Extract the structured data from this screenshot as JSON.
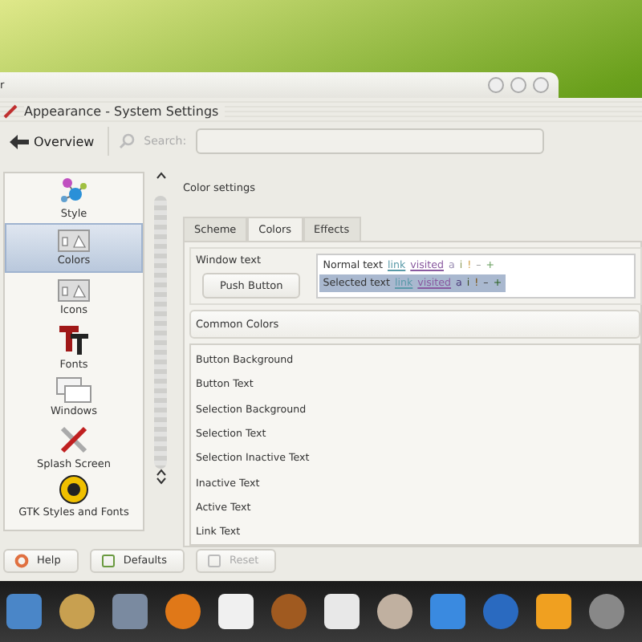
{
  "back_window": {
    "title": "r"
  },
  "window": {
    "title": "Appearance - System Settings"
  },
  "toolbar": {
    "overview": "Overview",
    "search_label": "Search:"
  },
  "sidebar": {
    "items": [
      {
        "label": "Style",
        "kind": "style",
        "selected": false
      },
      {
        "label": "Colors",
        "kind": "colors",
        "selected": true
      },
      {
        "label": "Icons",
        "kind": "colors",
        "selected": false
      },
      {
        "label": "Fonts",
        "kind": "fonts",
        "selected": false
      },
      {
        "label": "Windows",
        "kind": "windows",
        "selected": false
      },
      {
        "label": "Splash Screen",
        "kind": "tools",
        "selected": false
      },
      {
        "label": "GTK Styles and Fonts",
        "kind": "gtk",
        "selected": false
      }
    ]
  },
  "content": {
    "heading": "Color settings",
    "tabs": [
      {
        "label": "Scheme",
        "selected": false
      },
      {
        "label": "Colors",
        "selected": true
      },
      {
        "label": "Effects",
        "selected": false
      }
    ],
    "preview": {
      "window_text": "Window text",
      "push_button": "Push Button",
      "normal": {
        "text": "Normal text",
        "link": "link",
        "visited": "visited",
        "marks": [
          "a",
          "i",
          "!",
          "–",
          "+"
        ]
      },
      "selected": {
        "text": "Selected text",
        "link": "link",
        "visited": "visited",
        "marks": [
          "a",
          "i",
          "!",
          "–",
          "+"
        ]
      }
    },
    "color_set": "Common Colors",
    "roles": [
      "Button Background",
      "Button Text",
      "Selection Background",
      "Selection Text",
      "Selection Inactive Text",
      "Inactive Text",
      "Active Text",
      "Link Text"
    ]
  },
  "buttons": [
    {
      "label": "Help",
      "disabled": false
    },
    {
      "label": "Defaults",
      "disabled": false
    },
    {
      "label": "Reset",
      "disabled": true
    }
  ]
}
